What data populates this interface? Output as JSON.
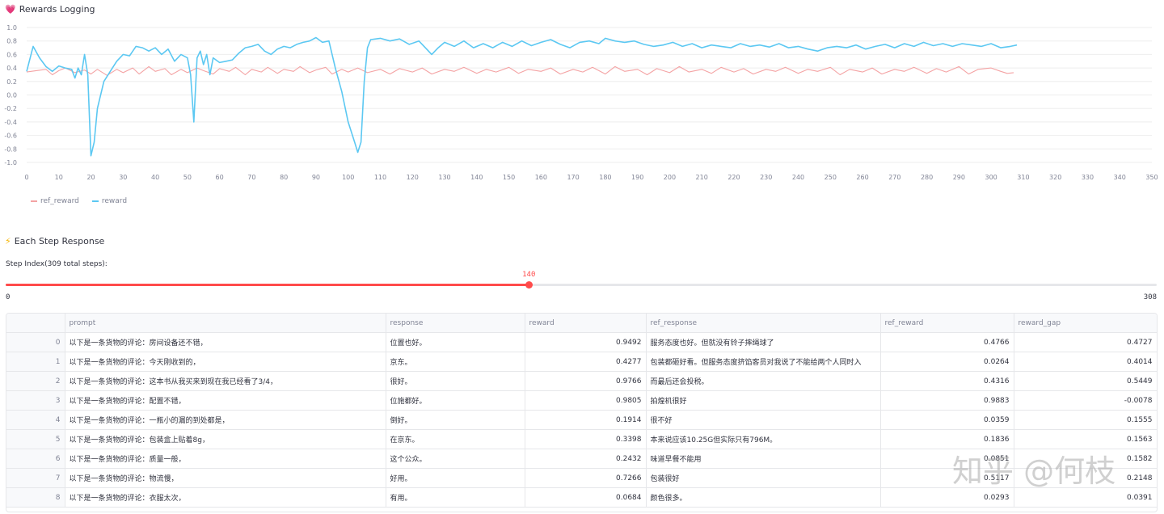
{
  "rewards_section": {
    "emoji": "💗",
    "title": "Rewards Logging"
  },
  "step_section": {
    "emoji": "⚡",
    "title": "Each Step Response"
  },
  "colors": {
    "ref_reward": "#f4a3a4",
    "reward": "#5cc8f2",
    "accent": "#ff4b4b"
  },
  "chart_data": {
    "type": "line",
    "xlim": [
      0,
      350
    ],
    "ylim": [
      -1.0,
      1.0
    ],
    "x_ticks": [
      "0",
      "10",
      "20",
      "30",
      "40",
      "50",
      "60",
      "70",
      "80",
      "90",
      "100",
      "110",
      "120",
      "130",
      "140",
      "150",
      "160",
      "170",
      "180",
      "190",
      "200",
      "210",
      "220",
      "230",
      "240",
      "250",
      "260",
      "270",
      "280",
      "290",
      "300",
      "310",
      "320",
      "330",
      "340",
      "350"
    ],
    "y_ticks": [
      "1.0",
      "0.8",
      "0.6",
      "0.4",
      "0.2",
      "0.0",
      "-0.2",
      "-0.4",
      "-0.6",
      "-0.8",
      "-1.0"
    ],
    "legend_position": "bottom-left",
    "series": [
      {
        "name": "ref_reward",
        "points": [
          [
            0,
            0.34
          ],
          [
            3,
            0.36
          ],
          [
            6,
            0.38
          ],
          [
            8,
            0.3
          ],
          [
            10,
            0.36
          ],
          [
            12,
            0.4
          ],
          [
            15,
            0.33
          ],
          [
            18,
            0.37
          ],
          [
            20,
            0.31
          ],
          [
            22,
            0.38
          ],
          [
            25,
            0.29
          ],
          [
            28,
            0.38
          ],
          [
            30,
            0.33
          ],
          [
            33,
            0.4
          ],
          [
            35,
            0.31
          ],
          [
            38,
            0.42
          ],
          [
            40,
            0.35
          ],
          [
            43,
            0.39
          ],
          [
            45,
            0.3
          ],
          [
            48,
            0.38
          ],
          [
            50,
            0.33
          ],
          [
            53,
            0.4
          ],
          [
            55,
            0.36
          ],
          [
            58,
            0.31
          ],
          [
            60,
            0.39
          ],
          [
            63,
            0.35
          ],
          [
            65,
            0.41
          ],
          [
            68,
            0.3
          ],
          [
            70,
            0.38
          ],
          [
            73,
            0.34
          ],
          [
            75,
            0.41
          ],
          [
            78,
            0.32
          ],
          [
            80,
            0.38
          ],
          [
            83,
            0.35
          ],
          [
            85,
            0.42
          ],
          [
            88,
            0.33
          ],
          [
            90,
            0.37
          ],
          [
            93,
            0.41
          ],
          [
            95,
            0.31
          ],
          [
            98,
            0.38
          ],
          [
            100,
            0.34
          ],
          [
            103,
            0.4
          ],
          [
            106,
            0.33
          ],
          [
            110,
            0.38
          ],
          [
            113,
            0.31
          ],
          [
            116,
            0.39
          ],
          [
            120,
            0.34
          ],
          [
            123,
            0.4
          ],
          [
            126,
            0.31
          ],
          [
            130,
            0.38
          ],
          [
            133,
            0.35
          ],
          [
            136,
            0.41
          ],
          [
            140,
            0.32
          ],
          [
            143,
            0.38
          ],
          [
            146,
            0.34
          ],
          [
            150,
            0.41
          ],
          [
            153,
            0.32
          ],
          [
            156,
            0.38
          ],
          [
            160,
            0.35
          ],
          [
            163,
            0.4
          ],
          [
            166,
            0.31
          ],
          [
            170,
            0.38
          ],
          [
            173,
            0.34
          ],
          [
            176,
            0.41
          ],
          [
            180,
            0.31
          ],
          [
            183,
            0.42
          ],
          [
            186,
            0.35
          ],
          [
            190,
            0.38
          ],
          [
            193,
            0.3
          ],
          [
            196,
            0.39
          ],
          [
            200,
            0.33
          ],
          [
            203,
            0.42
          ],
          [
            206,
            0.34
          ],
          [
            210,
            0.38
          ],
          [
            213,
            0.32
          ],
          [
            216,
            0.41
          ],
          [
            220,
            0.34
          ],
          [
            223,
            0.39
          ],
          [
            226,
            0.31
          ],
          [
            230,
            0.38
          ],
          [
            233,
            0.35
          ],
          [
            236,
            0.41
          ],
          [
            240,
            0.32
          ],
          [
            243,
            0.38
          ],
          [
            246,
            0.35
          ],
          [
            250,
            0.41
          ],
          [
            253,
            0.3
          ],
          [
            256,
            0.38
          ],
          [
            260,
            0.34
          ],
          [
            263,
            0.4
          ],
          [
            266,
            0.31
          ],
          [
            270,
            0.38
          ],
          [
            273,
            0.35
          ],
          [
            276,
            0.41
          ],
          [
            280,
            0.32
          ],
          [
            283,
            0.39
          ],
          [
            286,
            0.34
          ],
          [
            290,
            0.42
          ],
          [
            293,
            0.31
          ],
          [
            296,
            0.38
          ],
          [
            300,
            0.4
          ],
          [
            303,
            0.35
          ],
          [
            305,
            0.32
          ],
          [
            307,
            0.33
          ]
        ]
      },
      {
        "name": "reward",
        "points": [
          [
            0,
            0.35
          ],
          [
            2,
            0.72
          ],
          [
            4,
            0.55
          ],
          [
            6,
            0.42
          ],
          [
            8,
            0.35
          ],
          [
            10,
            0.43
          ],
          [
            12,
            0.4
          ],
          [
            14,
            0.38
          ],
          [
            15,
            0.25
          ],
          [
            16,
            0.4
          ],
          [
            17,
            0.3
          ],
          [
            18,
            0.6
          ],
          [
            19,
            0.3
          ],
          [
            20,
            -0.9
          ],
          [
            21,
            -0.7
          ],
          [
            22,
            -0.2
          ],
          [
            24,
            0.2
          ],
          [
            26,
            0.35
          ],
          [
            28,
            0.5
          ],
          [
            30,
            0.6
          ],
          [
            32,
            0.58
          ],
          [
            34,
            0.72
          ],
          [
            36,
            0.7
          ],
          [
            38,
            0.65
          ],
          [
            40,
            0.7
          ],
          [
            42,
            0.6
          ],
          [
            44,
            0.68
          ],
          [
            46,
            0.5
          ],
          [
            48,
            0.6
          ],
          [
            50,
            0.55
          ],
          [
            51,
            0.3
          ],
          [
            52,
            -0.4
          ],
          [
            53,
            0.55
          ],
          [
            54,
            0.65
          ],
          [
            55,
            0.45
          ],
          [
            56,
            0.6
          ],
          [
            57,
            0.3
          ],
          [
            58,
            0.55
          ],
          [
            60,
            0.48
          ],
          [
            62,
            0.5
          ],
          [
            64,
            0.52
          ],
          [
            66,
            0.62
          ],
          [
            68,
            0.7
          ],
          [
            70,
            0.72
          ],
          [
            72,
            0.75
          ],
          [
            74,
            0.65
          ],
          [
            76,
            0.6
          ],
          [
            78,
            0.68
          ],
          [
            80,
            0.72
          ],
          [
            82,
            0.7
          ],
          [
            84,
            0.75
          ],
          [
            86,
            0.78
          ],
          [
            88,
            0.8
          ],
          [
            90,
            0.85
          ],
          [
            92,
            0.78
          ],
          [
            94,
            0.8
          ],
          [
            96,
            0.4
          ],
          [
            98,
            0.05
          ],
          [
            100,
            -0.4
          ],
          [
            102,
            -0.7
          ],
          [
            103,
            -0.85
          ],
          [
            104,
            -0.7
          ],
          [
            105,
            0.2
          ],
          [
            106,
            0.7
          ],
          [
            107,
            0.82
          ],
          [
            110,
            0.84
          ],
          [
            113,
            0.8
          ],
          [
            116,
            0.83
          ],
          [
            119,
            0.75
          ],
          [
            122,
            0.8
          ],
          [
            124,
            0.7
          ],
          [
            126,
            0.6
          ],
          [
            128,
            0.7
          ],
          [
            130,
            0.78
          ],
          [
            133,
            0.72
          ],
          [
            136,
            0.8
          ],
          [
            139,
            0.7
          ],
          [
            142,
            0.76
          ],
          [
            145,
            0.7
          ],
          [
            148,
            0.78
          ],
          [
            151,
            0.72
          ],
          [
            154,
            0.8
          ],
          [
            157,
            0.73
          ],
          [
            160,
            0.78
          ],
          [
            163,
            0.82
          ],
          [
            166,
            0.75
          ],
          [
            169,
            0.7
          ],
          [
            172,
            0.78
          ],
          [
            175,
            0.8
          ],
          [
            178,
            0.76
          ],
          [
            180,
            0.84
          ],
          [
            183,
            0.8
          ],
          [
            186,
            0.78
          ],
          [
            189,
            0.8
          ],
          [
            192,
            0.75
          ],
          [
            195,
            0.72
          ],
          [
            198,
            0.74
          ],
          [
            201,
            0.78
          ],
          [
            204,
            0.72
          ],
          [
            207,
            0.76
          ],
          [
            210,
            0.7
          ],
          [
            213,
            0.74
          ],
          [
            216,
            0.72
          ],
          [
            219,
            0.7
          ],
          [
            222,
            0.76
          ],
          [
            225,
            0.72
          ],
          [
            228,
            0.74
          ],
          [
            231,
            0.71
          ],
          [
            234,
            0.76
          ],
          [
            237,
            0.7
          ],
          [
            240,
            0.72
          ],
          [
            243,
            0.68
          ],
          [
            246,
            0.65
          ],
          [
            249,
            0.7
          ],
          [
            252,
            0.72
          ],
          [
            255,
            0.7
          ],
          [
            258,
            0.74
          ],
          [
            261,
            0.68
          ],
          [
            264,
            0.72
          ],
          [
            267,
            0.75
          ],
          [
            270,
            0.7
          ],
          [
            273,
            0.76
          ],
          [
            276,
            0.72
          ],
          [
            279,
            0.78
          ],
          [
            282,
            0.73
          ],
          [
            285,
            0.76
          ],
          [
            288,
            0.72
          ],
          [
            291,
            0.76
          ],
          [
            294,
            0.74
          ],
          [
            297,
            0.72
          ],
          [
            300,
            0.76
          ],
          [
            303,
            0.7
          ],
          [
            306,
            0.72
          ],
          [
            308,
            0.74
          ]
        ]
      }
    ]
  },
  "slider": {
    "label": "Step Index(309 total steps):",
    "value": 140,
    "min": 0,
    "max": 308
  },
  "table": {
    "columns": [
      "",
      "prompt",
      "response",
      "reward",
      "ref_response",
      "ref_reward",
      "reward_gap"
    ],
    "rows": [
      [
        "0",
        "以下是一条货物的评论：房间设备还不错，",
        "位置也好。",
        "0.9492",
        "服务态度也好。但就没有铃子摔绳球了",
        "0.4766",
        "0.4727"
      ],
      [
        "1",
        "以下是一条货物的评论：今天刚收到的，",
        "京东。",
        "0.4277",
        "包装都砸好看。但服务态度挤馅客员对我说了不能给两个人同时入",
        "0.0264",
        "0.4014"
      ],
      [
        "2",
        "以下是一条货物的评论：这本书从我买来到现在我已经看了3/4，",
        "很好。",
        "0.9766",
        "而最后还会投税。",
        "0.4316",
        "0.5449"
      ],
      [
        "3",
        "以下是一条货物的评论：配置不错，",
        "位施都好。",
        "0.9805",
        "拍煌机很好",
        "0.9883",
        "-0.0078"
      ],
      [
        "4",
        "以下是一条货物的评论：一瓶小的漏的到处都是，",
        "倒好。",
        "0.1914",
        "很不好",
        "0.0359",
        "0.1555"
      ],
      [
        "5",
        "以下是一条货物的评论：包装盒上贴着8g，",
        "在京东。",
        "0.3398",
        "本来说应该10.25G但实际只有796M。",
        "0.1836",
        "0.1563"
      ],
      [
        "6",
        "以下是一条货物的评论：质量一般，",
        "这个公众。",
        "0.2432",
        "味道早餐不能用",
        "0.0851",
        "0.1582"
      ],
      [
        "7",
        "以下是一条货物的评论：物流慢，",
        "好用。",
        "0.7266",
        "包装很好",
        "0.5117",
        "0.2148"
      ],
      [
        "8",
        "以下是一条货物的评论：衣服太次，",
        "有用。",
        "0.0684",
        "颜色很多。",
        "0.0293",
        "0.0391"
      ]
    ]
  },
  "watermark": "知乎 @何枝"
}
